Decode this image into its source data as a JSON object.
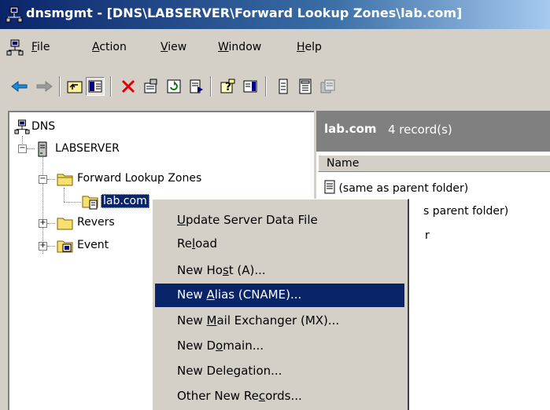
{
  "window": {
    "title": "dnsmgmt - [DNS\\LABSERVER\\Forward Lookup Zones\\lab.com]"
  },
  "menubar": {
    "items": [
      {
        "label": "File",
        "mnemonic": "F"
      },
      {
        "label": "Action",
        "mnemonic": "A"
      },
      {
        "label": "View",
        "mnemonic": "V"
      },
      {
        "label": "Window",
        "mnemonic": "W"
      },
      {
        "label": "Help",
        "mnemonic": "H"
      }
    ]
  },
  "toolbar": {
    "buttons": [
      "back-icon",
      "forward-icon",
      "up-folder-icon",
      "show-hide-tree-icon",
      "delete-icon",
      "properties-icon",
      "refresh-icon",
      "export-list-icon",
      "help-icon",
      "action-pane-icon",
      "new-record-icon",
      "new-zone-icon",
      "new-server-icon"
    ]
  },
  "tree": {
    "root": "DNS",
    "server": "LABSERVER",
    "forward_zones": "Forward Lookup Zones",
    "zone": "lab.com",
    "reverse": "Revers",
    "event": "Event",
    "expanded_symbol": "−",
    "collapsed_symbol": "+"
  },
  "details": {
    "title": "lab.com",
    "count": "4 record(s)",
    "column_name": "Name",
    "rows": [
      "(same as parent folder)",
      "s parent folder)",
      "r"
    ]
  },
  "context_menu": {
    "items": [
      {
        "label": "Update Server Data File",
        "mnemonic_index": 0
      },
      {
        "label": "Reload",
        "mnemonic_index": 2
      },
      {
        "label": "New Host (A)...",
        "mnemonic_index": 6
      },
      {
        "label": "New Alias (CNAME)...",
        "mnemonic_index": 4,
        "highlighted": true
      },
      {
        "label": "New Mail Exchanger (MX)...",
        "mnemonic_index": 4
      },
      {
        "label": "New Domain...",
        "mnemonic_index": 5
      },
      {
        "label": "New Delegation...",
        "mnemonic_index": 8
      },
      {
        "label": "Other New Records...",
        "mnemonic_index": 12
      }
    ]
  },
  "colors": {
    "title_start": "#0a246a",
    "title_end": "#a6caf0",
    "highlight": "#0a246a",
    "panel": "#d4d0c8",
    "header_grey": "#808080",
    "delete_red": "#e00000"
  }
}
